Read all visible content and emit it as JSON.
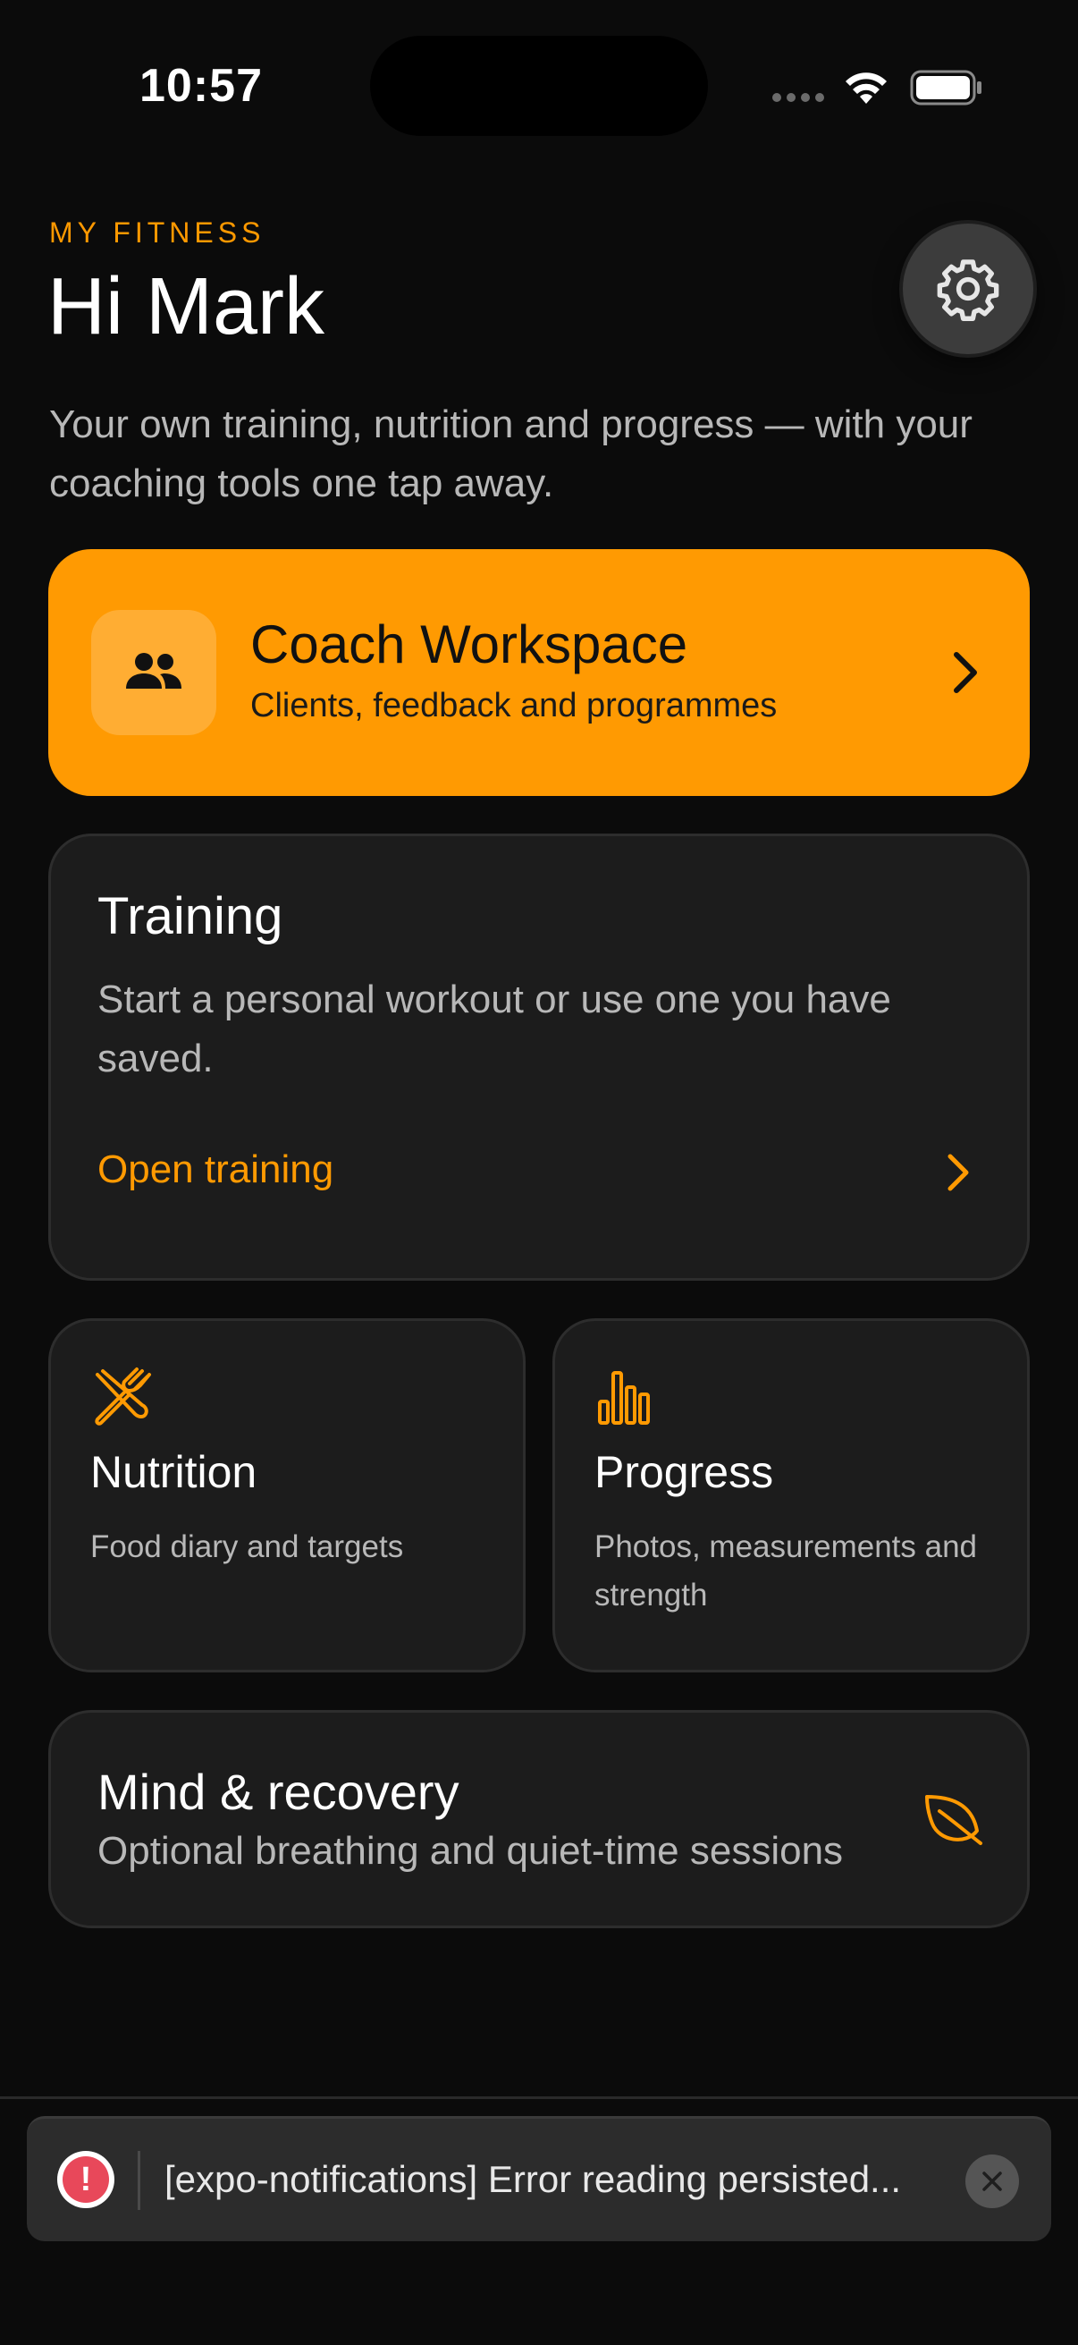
{
  "status_bar": {
    "time": "10:57"
  },
  "header": {
    "eyebrow": "MY FITNESS",
    "greeting": "Hi Mark",
    "subtitle": "Your own training, nutrition and progress — with your coaching tools one tap away.",
    "settings_icon": "gear-icon"
  },
  "coach_workspace": {
    "title": "Coach Workspace",
    "subtitle": "Clients, feedback and programmes",
    "icon": "people-icon",
    "accent": "#ff9a02"
  },
  "training": {
    "title": "Training",
    "description": "Start a personal workout or use one you have saved.",
    "link_label": "Open training"
  },
  "nutrition": {
    "title": "Nutrition",
    "description": "Food diary and targets",
    "icon": "fork-knife-icon"
  },
  "progress": {
    "title": "Progress",
    "description": "Photos, measurements and strength",
    "icon": "bar-chart-icon"
  },
  "mind_recovery": {
    "title": "Mind & recovery",
    "subtitle": "Optional breathing and quiet-time sessions",
    "icon": "leaf-icon"
  },
  "toast": {
    "message": "[expo-notifications] Error reading persisted...",
    "icon": "alert-icon",
    "alert_color": "#e8485a"
  }
}
